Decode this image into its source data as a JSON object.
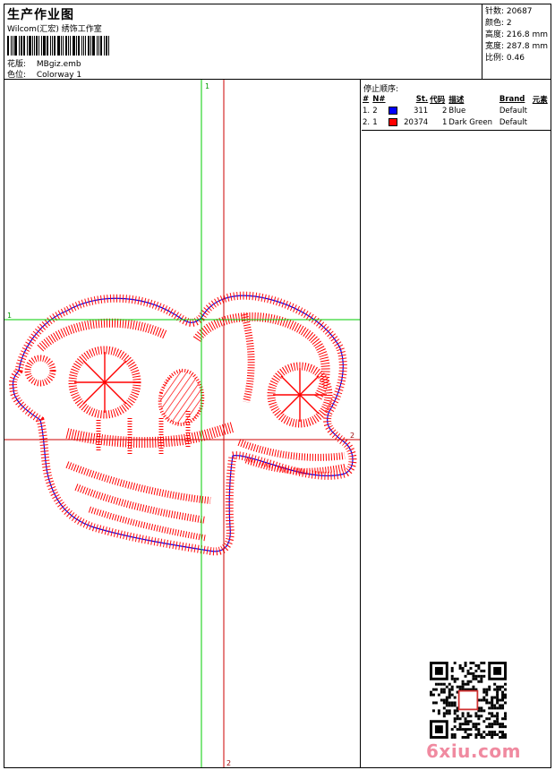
{
  "header": {
    "title": "生产作业图",
    "subtitle": "Wilcom(汇宏) 绣饰工作室",
    "pattern_label": "花版:",
    "pattern_value": "MBgiz.emb",
    "colorway_label": "色位:",
    "colorway_value": "Colorway 1"
  },
  "stats": {
    "stitches": "针数: 20687",
    "colors": "颜色: 2",
    "height": "高度: 216.8 mm",
    "width": "宽度: 287.8 mm",
    "scale": "比例: 0.46"
  },
  "design": {
    "guide_top_label": "1",
    "guide_left_label": "1",
    "guide_right_label": "2",
    "guide_bottom_label": "2",
    "colors": {
      "stitch": "#ff0000",
      "outline": "#0000ff",
      "guide_green": "#00cc00",
      "guide_red": "#cc0000"
    }
  },
  "stop_sequence": {
    "title": "停止顺序:",
    "headers": [
      "#",
      "N#",
      "",
      "St.",
      "代码",
      "描述",
      "Brand",
      "元素"
    ],
    "rows": [
      {
        "idx": "1.",
        "n": "2",
        "color": "#0000ff",
        "stitches": "311",
        "code": "2",
        "desc": "Blue",
        "brand": "Default"
      },
      {
        "idx": "2.",
        "n": "1",
        "color": "#ff0000",
        "stitches": "20374",
        "code": "1",
        "desc": "Dark Green",
        "brand": "Default"
      }
    ]
  },
  "watermark": {
    "text": "6xiu.com",
    "color": "#f08aa0"
  }
}
